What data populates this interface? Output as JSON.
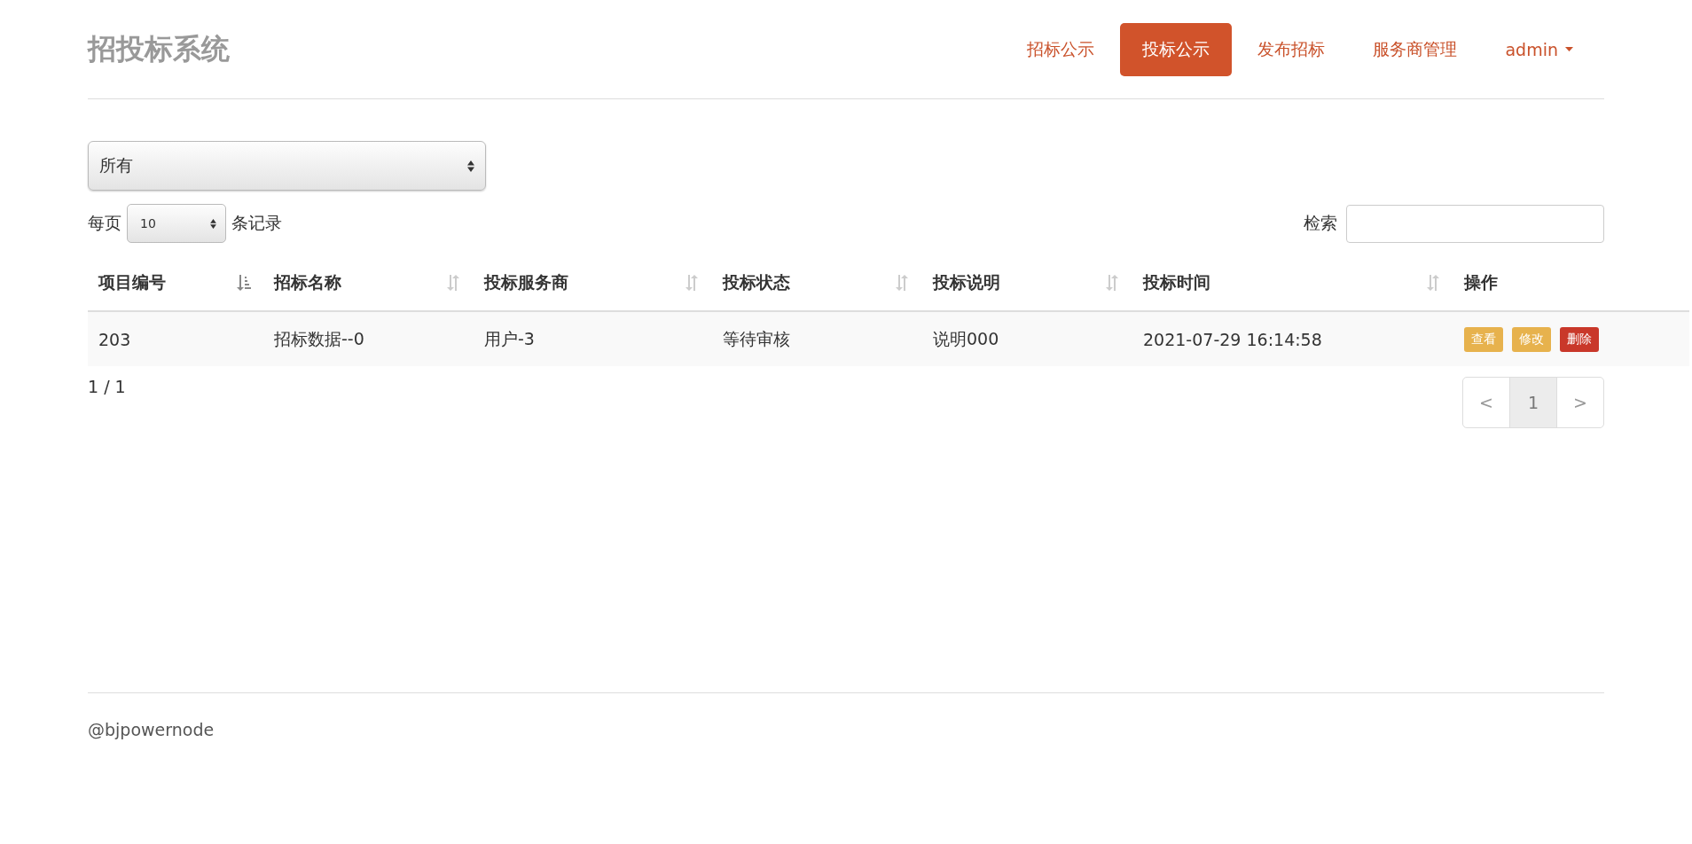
{
  "brand": "招投标系统",
  "nav": [
    {
      "label": "招标公示",
      "selected": false
    },
    {
      "label": "投标公示",
      "selected": true
    },
    {
      "label": "发布招标",
      "selected": false
    },
    {
      "label": "服务商管理",
      "selected": false
    },
    {
      "label": "admin",
      "selected": false,
      "kind": "dropdown"
    }
  ],
  "filter": {
    "value": "所有"
  },
  "page_size": {
    "prefix": "每页",
    "value": "10",
    "suffix": "条记录"
  },
  "search": {
    "label": "检索"
  },
  "table": {
    "columns": [
      {
        "label": "项目编号",
        "kind": "sorted"
      },
      {
        "label": "招标名称",
        "kind": "sortable"
      },
      {
        "label": "投标服务商",
        "kind": "sortable"
      },
      {
        "label": "投标状态",
        "kind": "sortable"
      },
      {
        "label": "投标说明",
        "kind": "sortable"
      },
      {
        "label": "投标时间",
        "kind": "sortable"
      },
      {
        "label": "操作",
        "kind": "plain"
      }
    ],
    "rows": [
      {
        "cells": [
          "203",
          "招标数据--0",
          "用户-3",
          "等待审核",
          "说明000",
          "2021-07-29 16:14:58"
        ],
        "actions": [
          {
            "label": "查看",
            "kind": "warning"
          },
          {
            "label": "修改",
            "kind": "warning"
          },
          {
            "label": "删除",
            "kind": "danger"
          }
        ]
      }
    ]
  },
  "page_info": "1 / 1",
  "pagination": [
    {
      "label": "<",
      "selected": false
    },
    {
      "label": "1",
      "selected": true
    },
    {
      "label": ">",
      "selected": false
    }
  ],
  "footer": "@bjpowernode"
}
